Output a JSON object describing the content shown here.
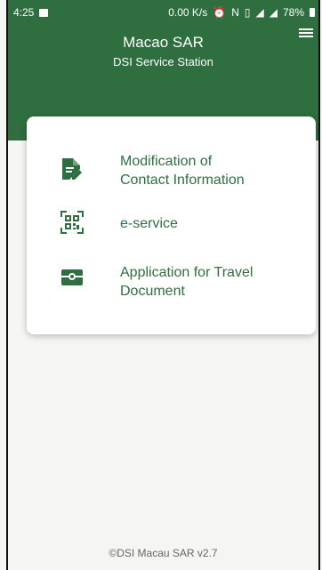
{
  "status_bar": {
    "time": "4:25",
    "net_speed": "0.00 K/s",
    "battery": "78%"
  },
  "header": {
    "title": "Macao SAR",
    "subtitle": "DSI Service Station"
  },
  "menu": {
    "items": [
      {
        "line1": "Modification of",
        "line2": "Contact Information",
        "icon": "edit-document-icon"
      },
      {
        "line1": "e-service",
        "line2": "",
        "icon": "qr-code-icon"
      },
      {
        "line1": "Application for Travel",
        "line2": "Document",
        "icon": "travel-document-icon"
      }
    ]
  },
  "footer": {
    "text": "©DSI Macau SAR v2.7"
  },
  "colors": {
    "primary": "#2f6f3f",
    "background": "#f5f6f4"
  }
}
